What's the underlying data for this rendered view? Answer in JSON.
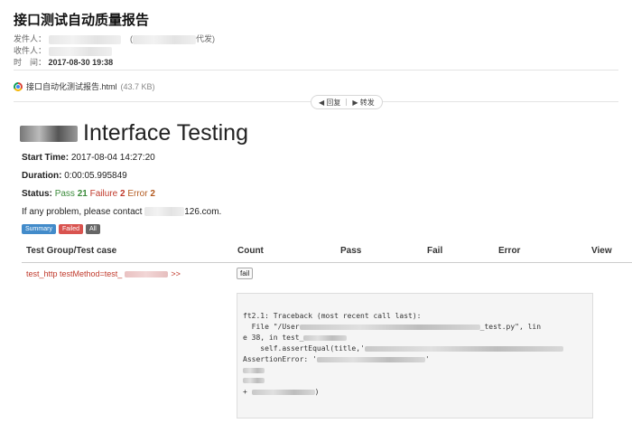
{
  "email": {
    "subject": "接口测试自动质量报告",
    "from_label": "发件人：",
    "from_suffix": "代发)",
    "to_label": "收件人：",
    "time_label": "时　间：",
    "time_value": "2017-08-30  19:38",
    "attachment_name": "接口自动化测试报告.html",
    "attachment_size": "(43.7 KB)",
    "reply_label": "回复",
    "forward_label": "转发"
  },
  "report": {
    "title_text": "Interface Testing",
    "start_label": "Start Time:",
    "start_value": "2017-08-04 14:27:20",
    "duration_label": "Duration:",
    "duration_value": "0:00:05.995849",
    "status_label": "Status:",
    "pass_label": "Pass",
    "pass_count": "21",
    "failure_label": "Failure",
    "failure_count": "2",
    "error_label": "Error",
    "error_count": "2",
    "contact_prefix": "If any problem, please contact",
    "contact_suffix": "126.com.",
    "filters": {
      "summary": "Summary",
      "failed": "Failed",
      "all": "All"
    },
    "columns": {
      "group": "Test Group/Test case",
      "count": "Count",
      "pass": "Pass",
      "fail": "Fail",
      "error": "Error",
      "view": "View"
    },
    "test_case": "test_http testMethod=test_",
    "test_case_arrow": ">>",
    "fail_button": "fail",
    "traceback": {
      "l1": "ft2.1: Traceback (most recent call last):",
      "l2a": "  File \"/User",
      "l2b": "_test.py\", lin",
      "l3a": "e 38, in test_",
      "l4": "    self.assertEqual(title,'",
      "l5": "AssertionError: '",
      "l6": "'",
      "l8a": "+ ",
      "l8b": ")"
    }
  },
  "colors": {
    "pass": "#3c8c3c",
    "fail": "#c0392b",
    "error": "#b35a1f",
    "summary": "#428bca",
    "failed_btn": "#d9534f"
  }
}
